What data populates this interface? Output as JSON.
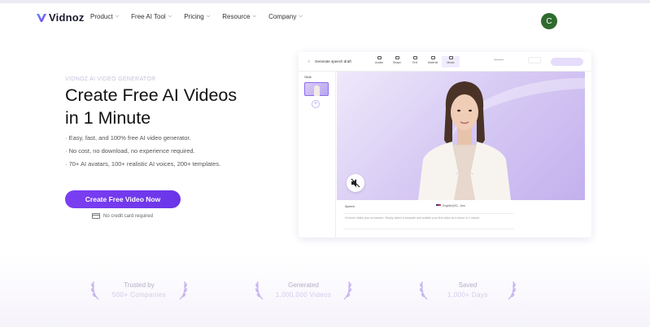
{
  "brand": {
    "name": "Vidnoz",
    "accent": "#7b3ff2"
  },
  "nav": {
    "items": [
      {
        "label": "Product"
      },
      {
        "label": "Free AI Tool"
      },
      {
        "label": "Pricing"
      },
      {
        "label": "Resource"
      },
      {
        "label": "Company"
      }
    ],
    "avatar_initial": "C"
  },
  "hero": {
    "eyebrow": "VIDNOZ AI VIDEO GENERATOR",
    "title_line1": "Create Free AI Videos",
    "title_line2": "in 1 Minute",
    "features": [
      "· Easy, fast, and 100% free AI video generator.",
      "· No cost, no download, no experience required.",
      "· 70+ AI avatars, 100+ realistic AI voices, 200+ templates."
    ],
    "cta_label": "Create Free Video Now",
    "no_card_note": "No credit card required"
  },
  "editor": {
    "back_icon": "chevron-left-icon",
    "project_title": "Generate speech draft",
    "tools": [
      {
        "label": "Avatar",
        "icon": "avatar-icon"
      },
      {
        "label": "Shape",
        "icon": "shape-icon"
      },
      {
        "label": "Text",
        "icon": "text-icon"
      },
      {
        "label": "Material",
        "icon": "material-icon"
      },
      {
        "label": "Music",
        "icon": "music-icon"
      }
    ],
    "sidebar_label": "Slide",
    "script_label": "Speech",
    "voice_label": "English(US) - Ava",
    "script_text": "Hi there! Make your ai narrator. Simply select a template and publish your first video as a demo in 1 minute."
  },
  "stats": [
    {
      "label": "Trusted by",
      "value": "500+ Companies"
    },
    {
      "label": "Generated",
      "value": "1,000,000 Videos"
    },
    {
      "label": "Saved",
      "value": "1,000+ Days"
    }
  ]
}
